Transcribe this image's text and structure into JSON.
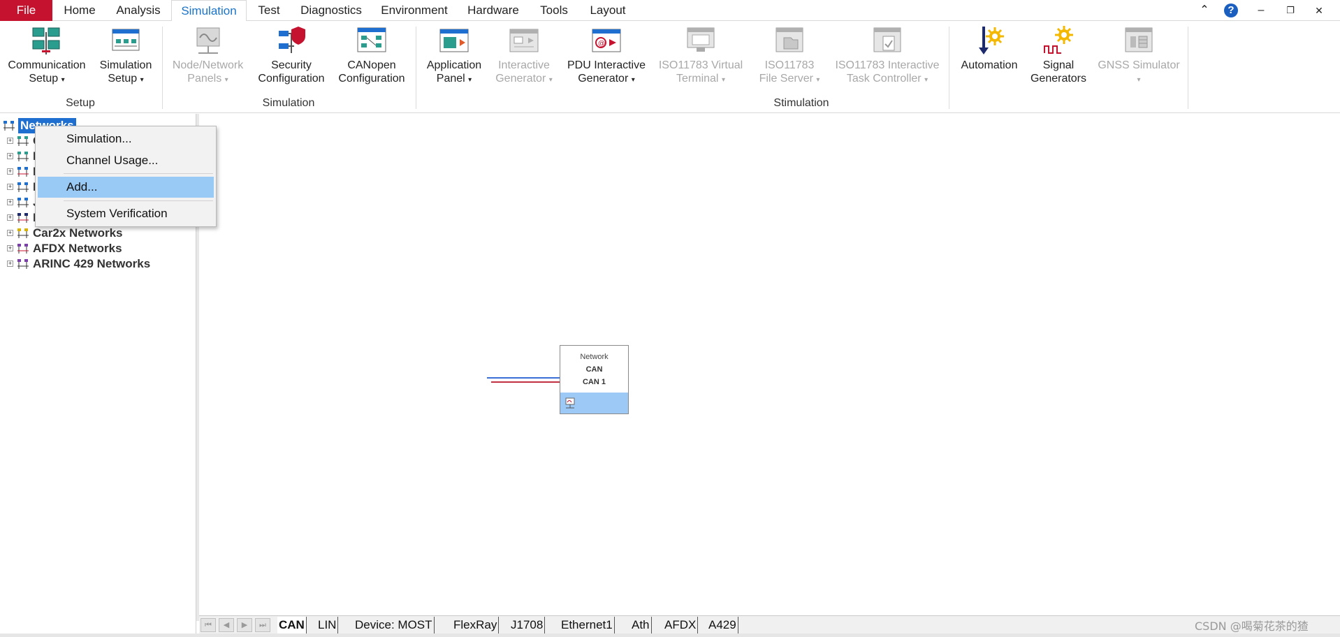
{
  "menu": {
    "tabs": [
      "File",
      "Home",
      "Analysis",
      "Simulation",
      "Test",
      "Diagnostics",
      "Environment",
      "Hardware",
      "Tools",
      "Layout"
    ],
    "active": "Simulation"
  },
  "window_controls": {
    "collapse": "⌃",
    "help": "?",
    "minimize": "–",
    "restore": "❐",
    "close": "✕"
  },
  "ribbon": {
    "buttons": [
      {
        "line1": "Communication",
        "line2": "Setup",
        "dropdown": true,
        "enabled": true,
        "icon": "communication-setup-icon"
      },
      {
        "line1": "Simulation",
        "line2": "Setup",
        "dropdown": true,
        "enabled": true,
        "icon": "simulation-setup-icon"
      },
      {
        "line1": "Node/Network",
        "line2": "Panels",
        "dropdown": true,
        "enabled": false,
        "icon": "node-network-panels-icon"
      },
      {
        "line1": "Security",
        "line2": "Configuration",
        "dropdown": false,
        "enabled": true,
        "icon": "security-configuration-icon"
      },
      {
        "line1": "CANopen",
        "line2": "Configuration",
        "dropdown": false,
        "enabled": true,
        "icon": "canopen-configuration-icon"
      },
      {
        "line1": "Application",
        "line2": "Panel",
        "dropdown": true,
        "enabled": true,
        "icon": "application-panel-icon"
      },
      {
        "line1": "Interactive",
        "line2": "Generator",
        "dropdown": true,
        "enabled": false,
        "icon": "interactive-generator-icon"
      },
      {
        "line1": "PDU Interactive",
        "line2": "Generator",
        "dropdown": true,
        "enabled": true,
        "icon": "pdu-interactive-generator-icon"
      },
      {
        "line1": "ISO11783 Virtual",
        "line2": "Terminal",
        "dropdown": true,
        "enabled": false,
        "icon": "iso11783-virtual-terminal-icon"
      },
      {
        "line1": "ISO11783",
        "line2": "File Server",
        "dropdown": true,
        "enabled": false,
        "icon": "iso11783-file-server-icon"
      },
      {
        "line1": "ISO11783 Interactive",
        "line2": "Task Controller",
        "dropdown": true,
        "enabled": false,
        "icon": "iso11783-task-controller-icon"
      },
      {
        "line1": "Automation",
        "line2": "",
        "dropdown": false,
        "enabled": true,
        "icon": "automation-icon"
      },
      {
        "line1": "Signal",
        "line2": "Generators",
        "dropdown": false,
        "enabled": true,
        "icon": "signal-generators-icon"
      },
      {
        "line1": "GNSS Simulator",
        "line2": "",
        "dropdown": true,
        "enabled": false,
        "icon": "gnss-simulator-icon"
      }
    ],
    "groups": [
      "Setup",
      "Simulation",
      "Stimulation"
    ]
  },
  "tree": {
    "root": "Networks",
    "items": [
      "C",
      "L",
      "F",
      "M",
      "J",
      "E",
      "Car2x Networks",
      "AFDX Networks",
      "ARINC 429 Networks"
    ]
  },
  "context_menu": {
    "items": [
      "Simulation...",
      "Channel Usage...",
      "Add...",
      "System Verification"
    ],
    "highlighted": "Add..."
  },
  "network_block": {
    "title": "Network",
    "type": "CAN",
    "name": "CAN 1"
  },
  "bottom_tabs": {
    "tabs": [
      "CAN",
      "LIN",
      "Device: MOST",
      "FlexRay",
      "J1708",
      "Ethernet1",
      "Ath",
      "AFDX",
      "A429"
    ],
    "active": "CAN",
    "nav": [
      "⏮",
      "◀",
      "▶",
      "⏭"
    ]
  },
  "watermark": "CSDN @喝菊花茶的猹",
  "colors": {
    "file_tab": "#c4122f",
    "active_tab_text": "#1a73c8",
    "selection": "#99c9f5",
    "tree_selection": "#1e6fd0"
  }
}
